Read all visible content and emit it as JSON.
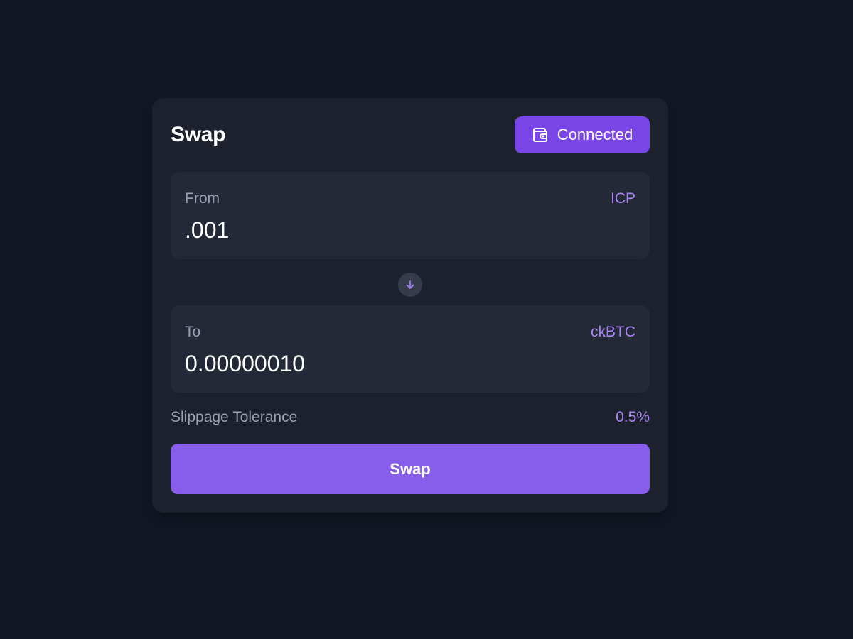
{
  "header": {
    "title": "Swap",
    "wallet_button_label": "Connected",
    "wallet_icon": "wallet-icon"
  },
  "from": {
    "label": "From",
    "token": "ICP",
    "amount": ".001"
  },
  "direction_icon": "arrow-down-icon",
  "to": {
    "label": "To",
    "token": "ckBTC",
    "amount": "0.00000010"
  },
  "slippage": {
    "label": "Slippage Tolerance",
    "value": "0.5%"
  },
  "swap_button_label": "Swap",
  "colors": {
    "background": "#131826",
    "card": "#1d212e",
    "panel": "#242938",
    "accent": "#7a45e6",
    "accent_button": "#875de9",
    "accent_text": "#a985f2",
    "muted_text": "#9aa1b2"
  }
}
